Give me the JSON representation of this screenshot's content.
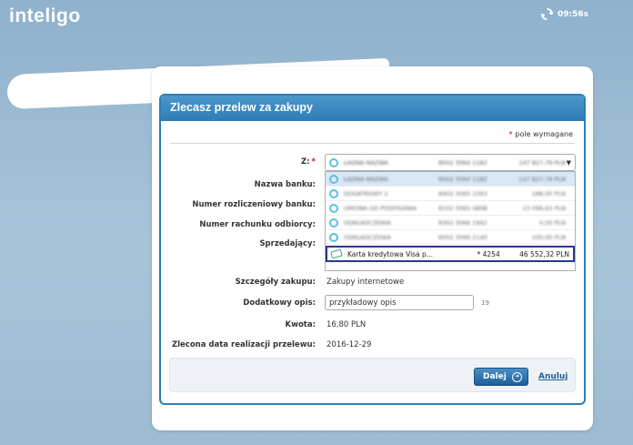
{
  "app": {
    "logo": "inteligo"
  },
  "session": {
    "timer": "09:56s",
    "icon": "refresh-icon"
  },
  "dialog": {
    "title": "Zlecasz przelew za zakupy",
    "required_star": "*",
    "required_note": "pole wymagane"
  },
  "form": {
    "from_label": "Z:",
    "from_star": "*",
    "bank_name_label": "Nazwa banku:",
    "settlement_number_label": "Numer rozliczeniowy banku:",
    "recipient_account_label": "Numer rachunku odbiorcy:",
    "seller_label": "Sprzedający:",
    "purchase_details_label": "Szczegóły zakupu:",
    "purchase_details_value": "Zakupy internetowe",
    "extra_desc_label": "Dodatkowy opis:",
    "extra_desc_value": "przykładowy opis",
    "extra_desc_counter": "19",
    "amount_label": "Kwota:",
    "amount_value": "16,80 PLN",
    "date_label": "Zlecona data realizacji przelewu:",
    "date_value": "2016-12-29"
  },
  "account_select": {
    "selected": {
      "name": "ŁADNA NAZWA",
      "number": "8502 3064 1182",
      "balance": "147 827,79 PLN"
    },
    "options": [
      {
        "name": "ŁADNA NAZWA",
        "number": "8502 3064 1182",
        "balance": "147 827,79 PLN"
      },
      {
        "name": "DODATKOWY 2",
        "number": "8402 3065 1093",
        "balance": "188,00 PLN"
      },
      {
        "name": "UMOWA DO PODPISANIA",
        "number": "8102 3065 4898",
        "balance": "23 096,63 PLN"
      },
      {
        "name": "ODKŁADCZENIA",
        "number": "8302 3066 1992",
        "balance": "0,00 PLN"
      },
      {
        "name": "ODKŁADCZENIA",
        "number": "8002 3066 2140",
        "balance": "100,00 PLN"
      }
    ],
    "card_option": {
      "name": "Karta kredytowa Visa p...",
      "number": "* 4254",
      "balance": "46 552,32 PLN"
    }
  },
  "footer": {
    "next_label": "Dalej",
    "cancel_label": "Anuluj"
  },
  "colors": {
    "accent": "#2f7db6",
    "highlight_border": "#2c3590",
    "required": "#e2001a"
  }
}
